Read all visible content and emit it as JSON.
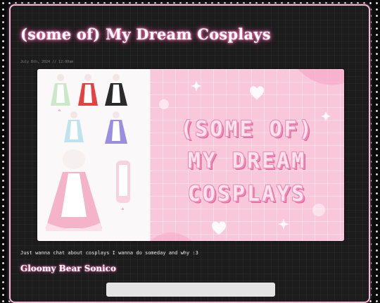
{
  "post": {
    "title": "(some of) My Dream Cosplays",
    "meta": "July 8th, 2024 // 12:00am",
    "banner_lines": [
      "(SOME OF)",
      "MY DREAM",
      "COSPLAYS"
    ],
    "intro": "Just wanna chat about cosplays I wanna do someday and why :3",
    "section_heading": "Gloomy Bear Sonico"
  },
  "colors": {
    "accent_pink": "#f2b8d2",
    "glow_pink": "#ff7fb8",
    "banner_pink": "#f9c7da",
    "background": "#0a0a0a"
  },
  "icons": [
    "heart-icon",
    "sparkle-icon"
  ]
}
